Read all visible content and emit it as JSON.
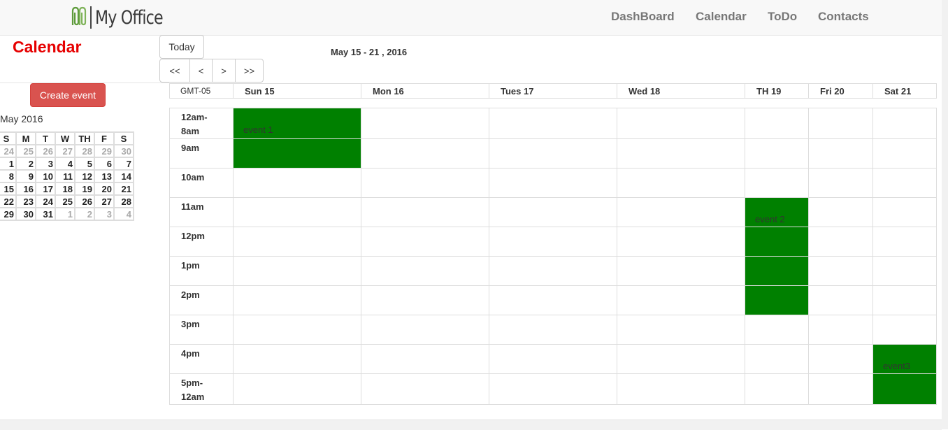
{
  "navbar": {
    "brand": "My Office",
    "links": [
      "DashBoard",
      "Calendar",
      "ToDo",
      "Contacts"
    ]
  },
  "page_title": "Calendar",
  "toolbar": {
    "today": "Today",
    "prev_prev": "<<",
    "prev": "<",
    "next": ">",
    "next_next": ">>",
    "week_range": "May 15 - 21 , 2016"
  },
  "sidebar": {
    "create_event": "Create event",
    "mini_calendar": {
      "title": "May 2016",
      "weekdays": [
        "S",
        "M",
        "T",
        "W",
        "TH",
        "F",
        "S"
      ],
      "weeks": [
        [
          {
            "d": "24",
            "m": true
          },
          {
            "d": "25",
            "m": true
          },
          {
            "d": "26",
            "m": true
          },
          {
            "d": "27",
            "m": true
          },
          {
            "d": "28",
            "m": true
          },
          {
            "d": "29",
            "m": true
          },
          {
            "d": "30",
            "m": true
          }
        ],
        [
          {
            "d": "1"
          },
          {
            "d": "2"
          },
          {
            "d": "3"
          },
          {
            "d": "4"
          },
          {
            "d": "5"
          },
          {
            "d": "6"
          },
          {
            "d": "7"
          }
        ],
        [
          {
            "d": "8"
          },
          {
            "d": "9"
          },
          {
            "d": "10"
          },
          {
            "d": "11"
          },
          {
            "d": "12"
          },
          {
            "d": "13"
          },
          {
            "d": "14"
          }
        ],
        [
          {
            "d": "15"
          },
          {
            "d": "16"
          },
          {
            "d": "17"
          },
          {
            "d": "18"
          },
          {
            "d": "19"
          },
          {
            "d": "20"
          },
          {
            "d": "21"
          }
        ],
        [
          {
            "d": "22"
          },
          {
            "d": "23"
          },
          {
            "d": "24"
          },
          {
            "d": "25"
          },
          {
            "d": "26"
          },
          {
            "d": "27"
          },
          {
            "d": "28"
          }
        ],
        [
          {
            "d": "29"
          },
          {
            "d": "30"
          },
          {
            "d": "31"
          },
          {
            "d": "1",
            "m": true
          },
          {
            "d": "2",
            "m": true
          },
          {
            "d": "3",
            "m": true
          },
          {
            "d": "4",
            "m": true
          }
        ]
      ]
    }
  },
  "week_view": {
    "timezone": "GMT-05",
    "days": [
      "Sun 15",
      "Mon 16",
      "Tues 17",
      "Wed 18",
      "TH 19",
      "Fri 20",
      "Sat 21"
    ],
    "slots": [
      "12am-\n8am",
      "9am",
      "10am",
      "11am",
      "12pm",
      "1pm",
      "2pm",
      "3pm",
      "4pm",
      "5pm-\n12am"
    ],
    "event_color": "#008000",
    "events": [
      {
        "label": "event 1",
        "day": 0,
        "start": 0,
        "end": 1
      },
      {
        "label": "event 2",
        "day": 4,
        "start": 3,
        "end": 6
      },
      {
        "label": "event3",
        "day": 6,
        "start": 8,
        "end": 9
      }
    ]
  }
}
